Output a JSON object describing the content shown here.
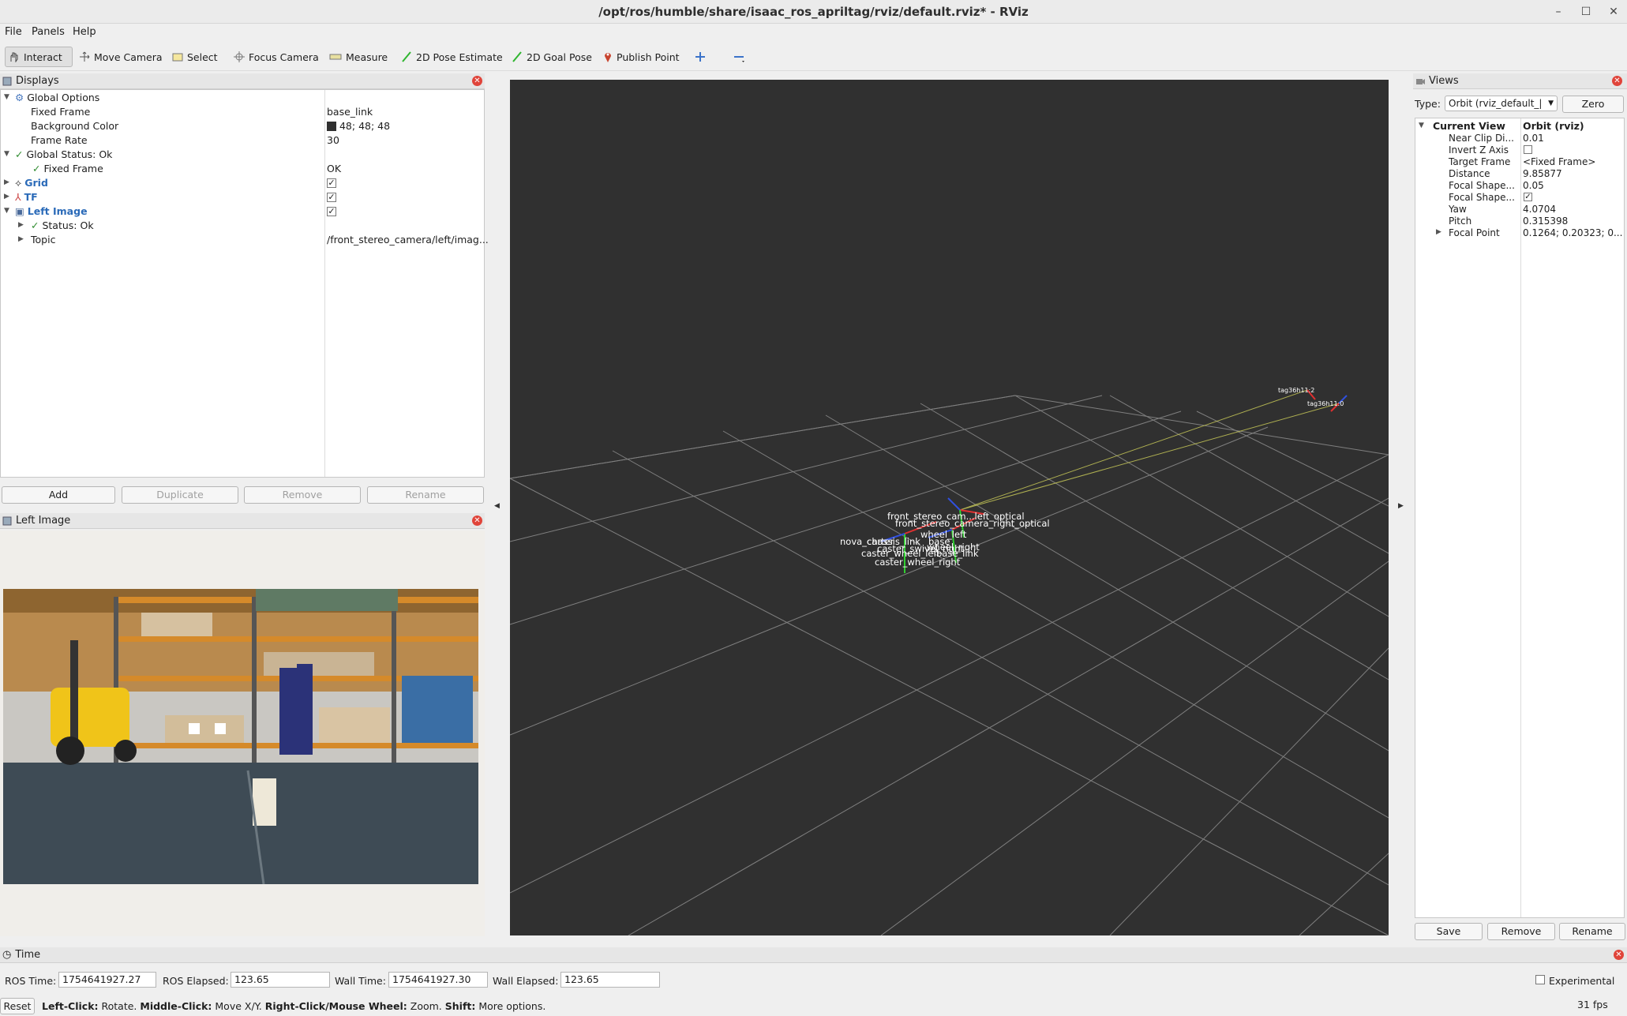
{
  "window": {
    "title": "/opt/ros/humble/share/isaac_ros_apriltag/rviz/default.rviz* - RViz",
    "controls": [
      "–",
      "☐",
      "✕"
    ]
  },
  "menu": [
    "File",
    "Panels",
    "Help"
  ],
  "toolbar": {
    "items": [
      "Interact",
      "Move Camera",
      "Select",
      "Focus Camera",
      "Measure",
      "2D Pose Estimate",
      "2D Goal Pose",
      "Publish Point"
    ]
  },
  "displays": {
    "title": "Displays",
    "global_options": "Global Options",
    "fixed_frame_label": "Fixed Frame",
    "fixed_frame_value": "base_link",
    "bg_color_label": "Background Color",
    "bg_color_value": "48; 48; 48",
    "bg_color_hex": "#303030",
    "frame_rate_label": "Frame Rate",
    "frame_rate_value": "30",
    "global_status": "Global Status: Ok",
    "global_status_fixed_frame": "Fixed Frame",
    "global_status_fixed_frame_value": "OK",
    "grid": "Grid",
    "tf": "TF",
    "left_image": "Left Image",
    "status_ok": "Status: Ok",
    "topic_label": "Topic",
    "topic_value": "/front_stereo_camera/left/imag...",
    "buttons": [
      "Add",
      "Duplicate",
      "Remove",
      "Rename"
    ]
  },
  "image_panel": {
    "title": "Left Image"
  },
  "viewport": {
    "frame_labels": [
      "front_stereo_cam...left_optical",
      "front_stereo_camera_right_optical",
      "wheel_left",
      "nova_carter",
      "chassis_link",
      "base",
      "wheel_right",
      "caster_wheel_left",
      "caster_swivel_right",
      "base_link",
      "caster_wheel_right",
      "tag36h11:2",
      "tag36h11:0"
    ]
  },
  "views": {
    "title": "Views",
    "type_label": "Type:",
    "type_value": "Orbit (rviz_default_|",
    "zero_button": "Zero",
    "current_view": "Current View",
    "current_view_value": "Orbit (rviz)",
    "props": [
      {
        "label": "Near Clip Di...",
        "value": "0.01"
      },
      {
        "label": "Invert Z Axis",
        "value": ""
      },
      {
        "label": "Target Frame",
        "value": "<Fixed Frame>"
      },
      {
        "label": "Distance",
        "value": "9.85877"
      },
      {
        "label": "Focal Shape...",
        "value": "0.05"
      },
      {
        "label": "Focal Shape...",
        "value": ""
      },
      {
        "label": "Yaw",
        "value": "4.0704"
      },
      {
        "label": "Pitch",
        "value": "0.315398"
      },
      {
        "label": "Focal Point",
        "value": "0.1264; 0.20323; 0..."
      }
    ],
    "buttons": [
      "Save",
      "Remove",
      "Rename"
    ]
  },
  "time": {
    "title": "Time",
    "ros_time_label": "ROS Time:",
    "ros_time": "1754641927.27",
    "ros_elapsed_label": "ROS Elapsed:",
    "ros_elapsed": "123.65",
    "wall_time_label": "Wall Time:",
    "wall_time": "1754641927.30",
    "wall_elapsed_label": "Wall Elapsed:",
    "wall_elapsed": "123.65",
    "experimental": "Experimental"
  },
  "status": {
    "reset": "Reset",
    "hint_b1": "Left-Click:",
    "hint_t1": " Rotate. ",
    "hint_b2": "Middle-Click:",
    "hint_t2": " Move X/Y. ",
    "hint_b3": "Right-Click/Mouse Wheel:",
    "hint_t3": " Zoom. ",
    "hint_b4": "Shift:",
    "hint_t4": " More options.",
    "fps": "31 fps"
  }
}
